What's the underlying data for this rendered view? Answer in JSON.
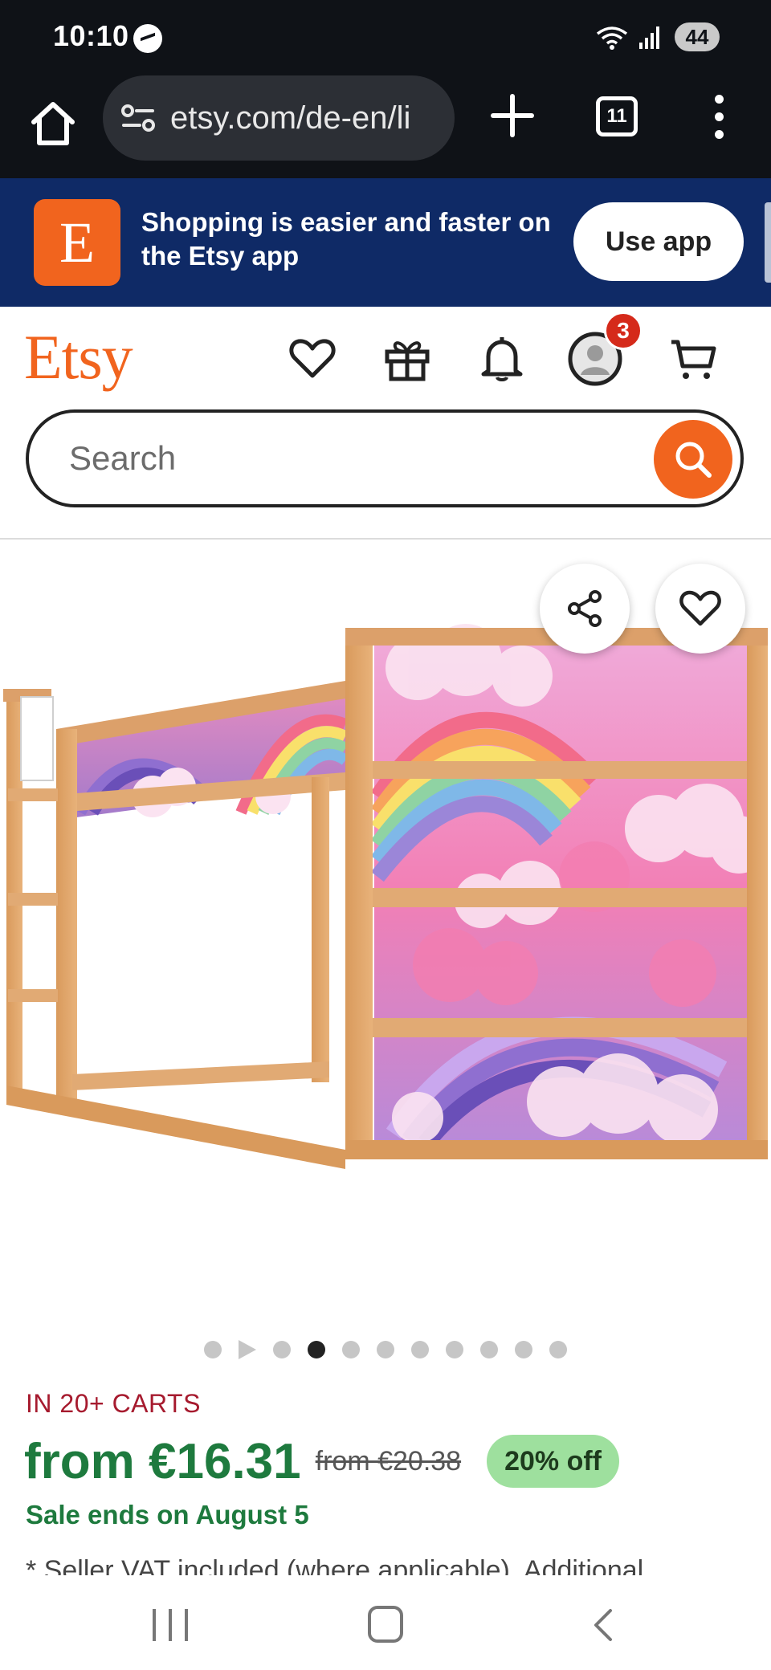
{
  "status_bar": {
    "time": "10:10",
    "battery": "44",
    "icons": [
      "messenger-icon",
      "wifi-icon",
      "signal-icon",
      "battery-icon"
    ]
  },
  "browser": {
    "url": "etsy.com/de-en/li",
    "tab_count": "11",
    "icons": [
      "home-icon",
      "site-settings-icon",
      "new-tab-icon",
      "tabs-icon",
      "menu-icon"
    ]
  },
  "app_banner": {
    "app_icon_letter": "E",
    "message": "Shopping is easier and faster on the Etsy app",
    "button": "Use app"
  },
  "header": {
    "logo": "Etsy",
    "notification_count": "3",
    "icons": [
      "heart-icon",
      "gift-icon",
      "bell-icon",
      "avatar-icon",
      "cart-icon"
    ]
  },
  "search": {
    "placeholder": "Search"
  },
  "product": {
    "image_alt": "Wooden loft bed with rainbow and cloud sticker panels",
    "carousel": {
      "total_items": 11,
      "active_index": 3,
      "video_index": 1
    },
    "in_carts": "IN 20+ CARTS",
    "price": "from €16.31",
    "original_price": "from €20.38",
    "discount": "20% off",
    "sale_ends": "Sale ends on August 5",
    "vat_note": "* Seller VAT included (where applicable). Additional"
  },
  "colors": {
    "etsy_orange": "#f1641e",
    "banner_navy": "#0f2a66",
    "price_green": "#1e7a3e",
    "carts_red": "#a61a2e",
    "discount_bg": "#9ee09e"
  }
}
